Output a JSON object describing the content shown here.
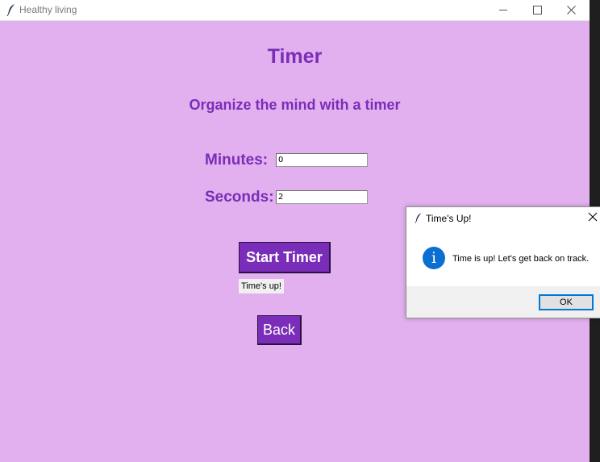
{
  "window": {
    "title": "Healthy living"
  },
  "timer": {
    "title": "Timer",
    "subtitle": "Organize the mind with a timer",
    "minutes_label": "Minutes:",
    "minutes_value": "0",
    "seconds_label": "Seconds:",
    "seconds_value": "2",
    "start_button": "Start Timer",
    "status": "Time's up!",
    "back_button": "Back"
  },
  "dialog": {
    "title": "Time's Up!",
    "message": "Time is up! Let's get back on track.",
    "ok_button": "OK",
    "icon": "info-icon"
  },
  "colors": {
    "background": "#e2b0ee",
    "accent": "#7a2db8",
    "dialog_button_border": "#0078d7"
  }
}
